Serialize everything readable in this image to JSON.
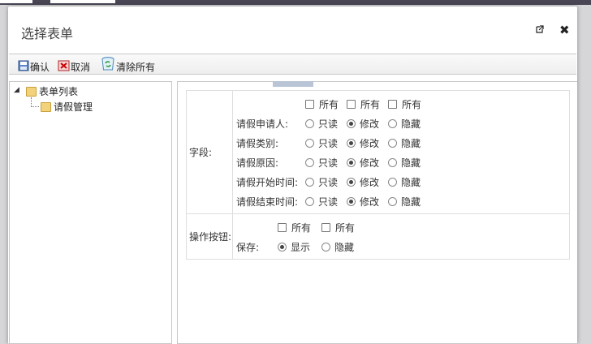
{
  "dialog": {
    "title": "选择表单"
  },
  "toolbar": {
    "confirm": "确认",
    "cancel": "取消",
    "clear_all": "清除所有"
  },
  "tree": {
    "root": "表单列表",
    "child": "请假管理"
  },
  "fields_section": {
    "label": "字段:",
    "select_all": [
      "所有",
      "所有",
      "所有"
    ],
    "option_labels": [
      "只读",
      "修改",
      "隐藏"
    ],
    "rows": [
      {
        "name": "请假申请人:",
        "selected": "修改"
      },
      {
        "name": "请假类别:",
        "selected": "修改"
      },
      {
        "name": "请假原因:",
        "selected": "修改"
      },
      {
        "name": "请假开始时间:",
        "selected": "修改"
      },
      {
        "name": "请假结束时间:",
        "selected": "修改"
      }
    ]
  },
  "buttons_section": {
    "label": "操作按钮:",
    "select_all": [
      "所有",
      "所有"
    ],
    "option_labels": [
      "显示",
      "隐藏"
    ],
    "rows": [
      {
        "name": "保存:",
        "selected": "显示"
      }
    ]
  }
}
